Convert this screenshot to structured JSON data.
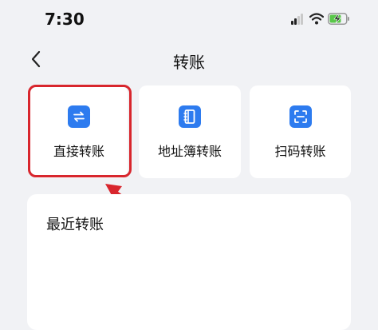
{
  "status_bar": {
    "time": "7:30",
    "signal_icon": "signal-icon",
    "wifi_icon": "wifi-icon",
    "battery_icon": "battery-charging-icon",
    "battery_color": "#59c749"
  },
  "nav": {
    "back_icon": "chevron-left-icon",
    "title": "转账"
  },
  "options": [
    {
      "label": "直接转账",
      "icon": "transfer-arrows-icon"
    },
    {
      "label": "地址簿转账",
      "icon": "address-book-icon"
    },
    {
      "label": "扫码转账",
      "icon": "scan-icon"
    }
  ],
  "recent": {
    "title": "最近转账"
  },
  "annotation": {
    "color": "#d8262d",
    "target": "直接转账"
  },
  "colors": {
    "accent": "#2d7bef",
    "background": "#f1f2f5",
    "card": "#ffffff"
  }
}
